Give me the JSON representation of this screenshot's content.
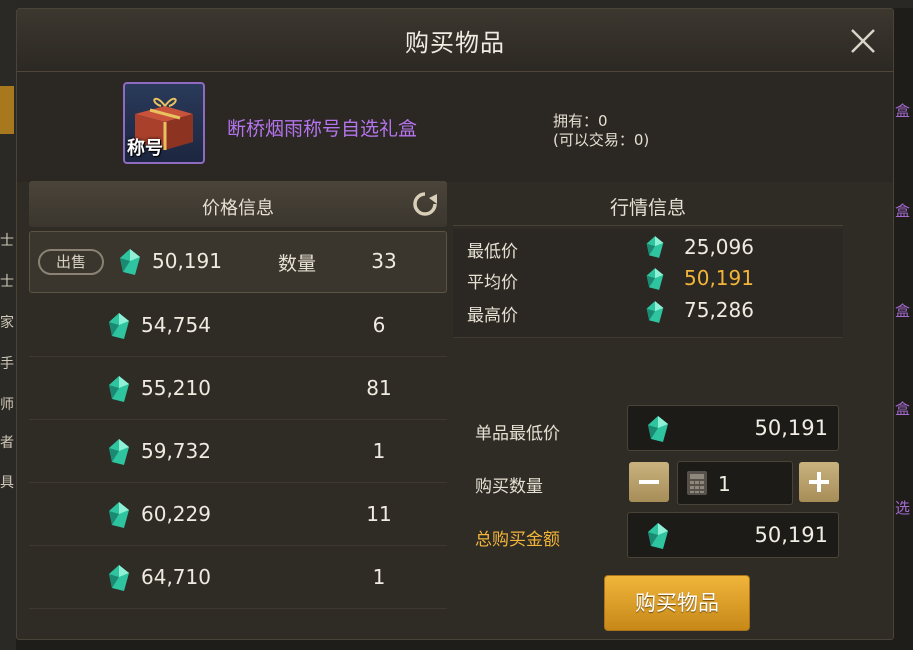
{
  "dialog": {
    "title": "购买物品"
  },
  "item": {
    "badge": "称号",
    "name": "断桥烟雨称号自选礼盒",
    "owned": "拥有：0",
    "tradeable": "(可以交易：0)"
  },
  "price_panel": {
    "header": "价格信息",
    "sell_label": "出售",
    "quantity_label": "数量",
    "listings": [
      {
        "price": "50,191",
        "qty": "33"
      },
      {
        "price": "54,754",
        "qty": "6"
      },
      {
        "price": "55,210",
        "qty": "81"
      },
      {
        "price": "59,732",
        "qty": "1"
      },
      {
        "price": "60,229",
        "qty": "11"
      },
      {
        "price": "64,710",
        "qty": "1"
      }
    ]
  },
  "market": {
    "title": "行情信息",
    "min_label": "最低价",
    "min_value": "25,096",
    "avg_label": "平均价",
    "avg_value": "50,191",
    "max_label": "最高价",
    "max_value": "75,286"
  },
  "purchase": {
    "unit_price_label": "单品最低价",
    "unit_price": "50,191",
    "quantity_label": "购买数量",
    "quantity": "1",
    "total_label": "总购买金额",
    "total": "50,191",
    "buy_button": "购买物品"
  },
  "colors": {
    "accent_gold": "#f2b53a",
    "item_name_purple": "#b474ee",
    "gem": "#2ec4a0"
  },
  "background": {
    "left_tabs": [
      "士",
      "士",
      "家",
      "手",
      "师",
      "者",
      "具"
    ],
    "right_fragments": [
      "盒",
      "盒",
      "盒",
      "盒",
      "选"
    ]
  }
}
